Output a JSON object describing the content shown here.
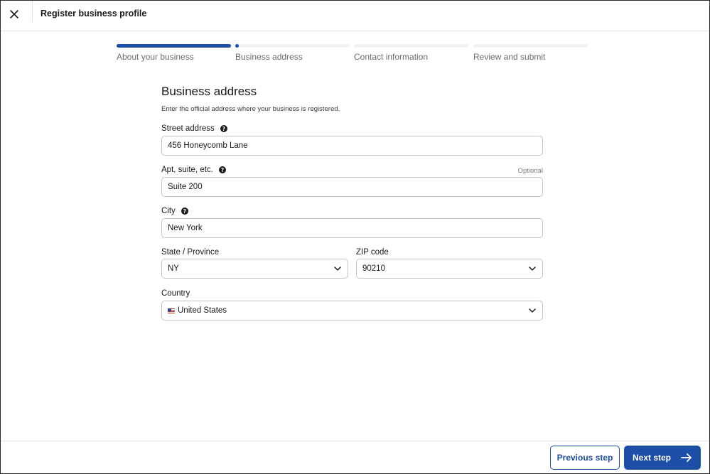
{
  "header": {
    "title": "Register business profile",
    "close_icon": "close-icon"
  },
  "stepper": {
    "steps": [
      {
        "label": "About your business",
        "progress": 1.0
      },
      {
        "label": "Business address",
        "progress": 0.0
      },
      {
        "label": "Contact information",
        "progress": 0.0
      },
      {
        "label": "Review and submit",
        "progress": 0.0
      }
    ],
    "current_index": 1
  },
  "form": {
    "title": "Business address",
    "description": "Enter the official address where your business is registered.",
    "street": {
      "label": "Street address",
      "value": "456 Honeycomb Lane"
    },
    "apt": {
      "label": "Apt, suite, etc.",
      "optional": "Optional",
      "value": "Suite 200"
    },
    "city": {
      "label": "City",
      "value": "New York"
    },
    "state": {
      "label": "State / Province",
      "value": "NY"
    },
    "zip": {
      "label": "ZIP code",
      "value": "90210"
    },
    "country": {
      "label": "Country",
      "value": "United States",
      "flag_icon": "us-flag-icon"
    }
  },
  "footer": {
    "previous_label": "Previous step",
    "next_label": "Next step"
  },
  "colors": {
    "accent": "#1c4fa8",
    "border": "#c4c4c4"
  }
}
